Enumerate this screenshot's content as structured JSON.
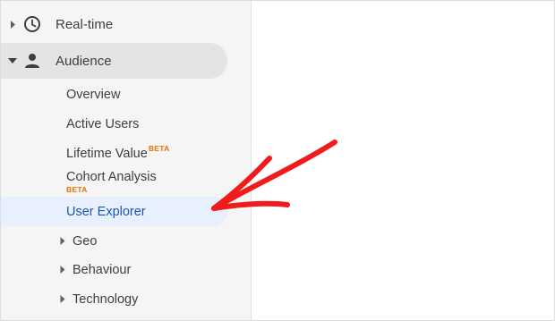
{
  "nav": {
    "realtime": {
      "label": "Real-time",
      "icon": "clock-icon"
    },
    "audience": {
      "label": "Audience",
      "icon": "person-icon",
      "expanded": true
    },
    "audience_items": [
      {
        "label": "Overview"
      },
      {
        "label": "Active Users"
      },
      {
        "label": "Lifetime Value",
        "badge": "BETA"
      },
      {
        "label": "Cohort Analysis",
        "badge": "BETA"
      },
      {
        "label": "User Explorer",
        "selected": true
      }
    ],
    "audience_groups": [
      {
        "label": "Geo"
      },
      {
        "label": "Behaviour"
      },
      {
        "label": "Technology"
      }
    ]
  },
  "annotation": {
    "type": "hand-drawn-arrow",
    "color": "#f01c1c",
    "points_to": "User Explorer"
  },
  "colors": {
    "sidebar_bg": "#f5f5f5",
    "active_bg": "#e4e4e4",
    "selected_bg": "#e8f0fe",
    "selected_text": "#1a56b3",
    "badge": "#e37400",
    "arrow": "#f01c1c"
  }
}
